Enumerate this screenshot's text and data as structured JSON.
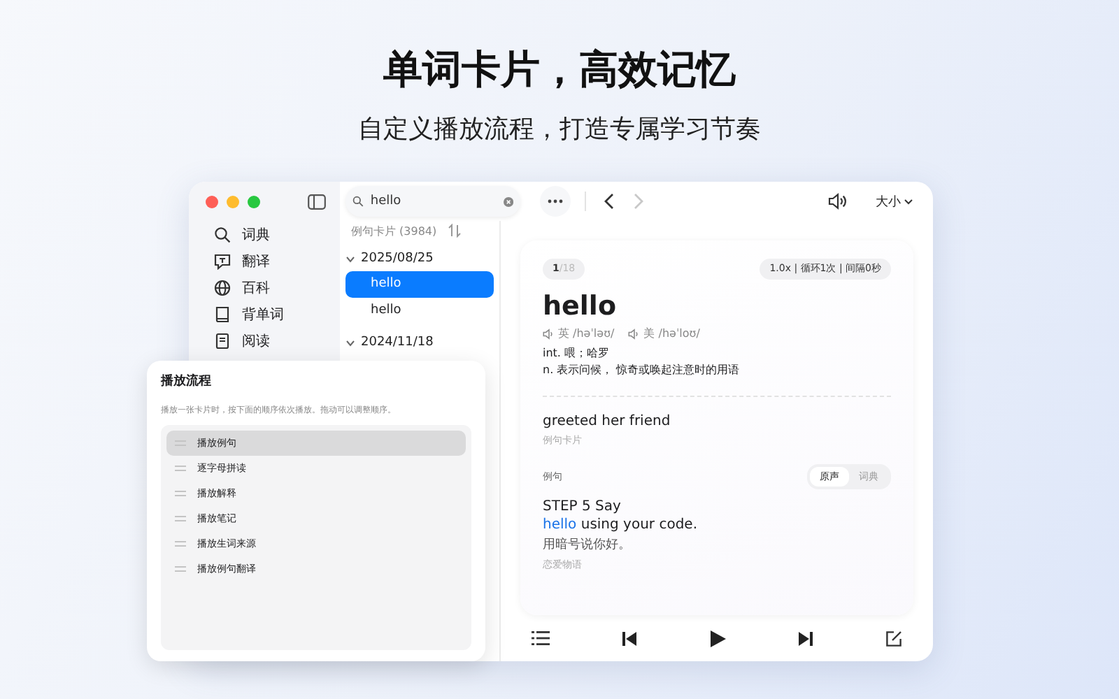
{
  "hero": {
    "title": "单词卡片，高效记忆",
    "subtitle": "自定义播放流程，打造专属学习节奏"
  },
  "sidebar": {
    "items": [
      {
        "label": "词典",
        "selected": false
      },
      {
        "label": "翻译",
        "selected": false
      },
      {
        "label": "百科",
        "selected": false
      },
      {
        "label": "背单词",
        "selected": false
      },
      {
        "label": "阅读",
        "selected": false
      }
    ]
  },
  "toolbar": {
    "search": {
      "value": "hello"
    },
    "size_menu": "大小"
  },
  "list": {
    "header": "例句卡片 (3984)",
    "groups": [
      {
        "date": "2025/08/25",
        "expanded": true,
        "items": [
          {
            "label": "hello",
            "selected": true
          },
          {
            "label": "hello",
            "selected": false
          }
        ]
      },
      {
        "date": "2024/11/18",
        "expanded": true
      }
    ]
  },
  "card": {
    "counter_current": "1",
    "counter_total": "/18",
    "playback": "1.0x | 循环1次 | 间隔0秒",
    "word": "hello",
    "pronunciations": [
      "英 /həˈləʊ/",
      "美 /həˈloʊ/"
    ],
    "definitions": [
      "int. 喂；哈罗",
      "n. 表示问候， 惊奇或唤起注意时的用语"
    ],
    "note": {
      "text": "greeted her friend",
      "source": "例句卡片"
    },
    "examples": {
      "label": "例句",
      "tabs": [
        {
          "label": "原声",
          "selected": true
        },
        {
          "label": "词典",
          "selected": false
        }
      ],
      "line1": "STEP 5 Say",
      "highlight": "hello",
      "line2_rest": "using your code.",
      "translation": "用暗号说你好。",
      "source": "恋爱物语"
    }
  },
  "flow_panel": {
    "title": "播放流程",
    "hint": "播放一张卡片时，按下面的顺序依次播放。拖动可以调整顺序。",
    "steps": [
      {
        "label": "播放例句",
        "selected": true
      },
      {
        "label": "逐字母拼读",
        "selected": false
      },
      {
        "label": "播放解释",
        "selected": false
      },
      {
        "label": "播放笔记",
        "selected": false
      },
      {
        "label": "播放生词来源",
        "selected": false
      },
      {
        "label": "播放例句翻译",
        "selected": false
      }
    ]
  }
}
